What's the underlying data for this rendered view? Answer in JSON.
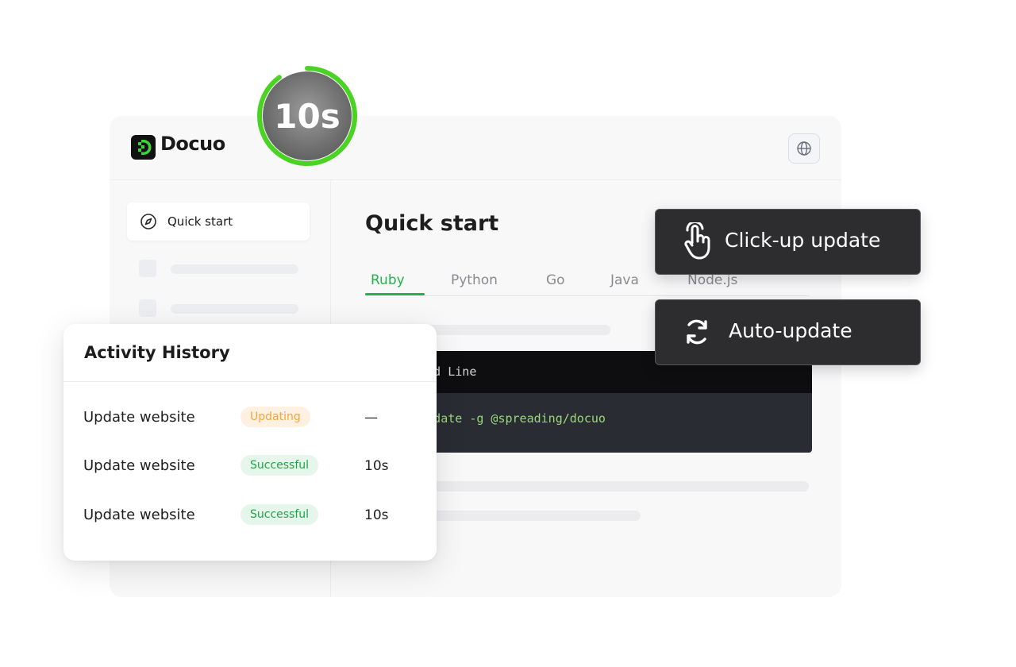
{
  "app": {
    "name": "Docuo",
    "accent_color": "#23b34d",
    "language_icon": "globe-icon"
  },
  "timer": {
    "label": "10s",
    "progress": 0.9,
    "ring_color": "#4ad322"
  },
  "sidebar": {
    "active_item": {
      "label": "Quick start",
      "icon": "compass-icon"
    }
  },
  "content": {
    "title": "Quick start",
    "tabs": [
      {
        "label": "Ruby",
        "active": true
      },
      {
        "label": "Python",
        "active": false
      },
      {
        "label": "Go",
        "active": false
      },
      {
        "label": "Java",
        "active": false
      },
      {
        "label": "Node.js",
        "active": false
      }
    ],
    "code_block": {
      "header": "Command Line",
      "code": "npm update -g @spreading/docuo"
    }
  },
  "activity": {
    "title": "Activity History",
    "rows": [
      {
        "name": "Update website",
        "status": "Updating",
        "time": "—"
      },
      {
        "name": "Update website",
        "status": "Successful",
        "time": "10s"
      },
      {
        "name": "Update website",
        "status": "Successful",
        "time": "10s"
      }
    ]
  },
  "update_options": [
    {
      "label": "Click-up update",
      "icon": "hand-pointer-icon"
    },
    {
      "label": "Auto-update",
      "icon": "refresh-icon"
    }
  ]
}
